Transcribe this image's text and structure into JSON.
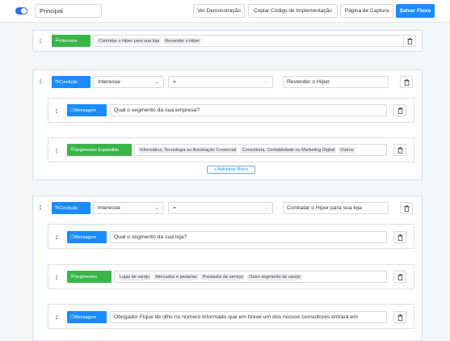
{
  "topbar": {
    "flow_name": "Principal",
    "buttons": [
      "Ver Demonstração",
      "Copiar Código de Implementação",
      "Página de Captura",
      "Salvar Fluxo"
    ]
  },
  "block1": {
    "tag": "Interesse",
    "chips": [
      "Contratar o Hiper para sua loja",
      "Revender o Hiper"
    ]
  },
  "block2": {
    "tag": "Condição",
    "variable": "Interesse",
    "operator": "=",
    "value": "Revender o Hiper",
    "message": {
      "tag": "Mensagem",
      "text": "Qual o segmento da sua empresa?"
    },
    "expanded": {
      "tag": "Segmentos Expandido",
      "chips": [
        "Informática, Tecnologia ou Automação Comercial",
        "Consultoria, Contabilidade ou Marketing Digital",
        "Outros"
      ]
    },
    "add_label": "+ Adicionar Bloco"
  },
  "block3": {
    "tag": "Condição",
    "variable": "Interesse",
    "operator": "=",
    "value": "Contratar o Hiper para sua loja",
    "message1": {
      "tag": "Mensagem",
      "text": "Qual o segmento da sua loja?"
    },
    "segments": {
      "tag": "Segmentos",
      "chips": [
        "Lojas de varejo",
        "Mercados e padarias",
        "Prestador de serviço",
        "Outro segmento de varejo"
      ]
    },
    "message2": {
      "tag": "Mensagem",
      "text": "Obrigado! Fique de olho no número informado que em breve um dos nossos consultores entrará em"
    }
  }
}
